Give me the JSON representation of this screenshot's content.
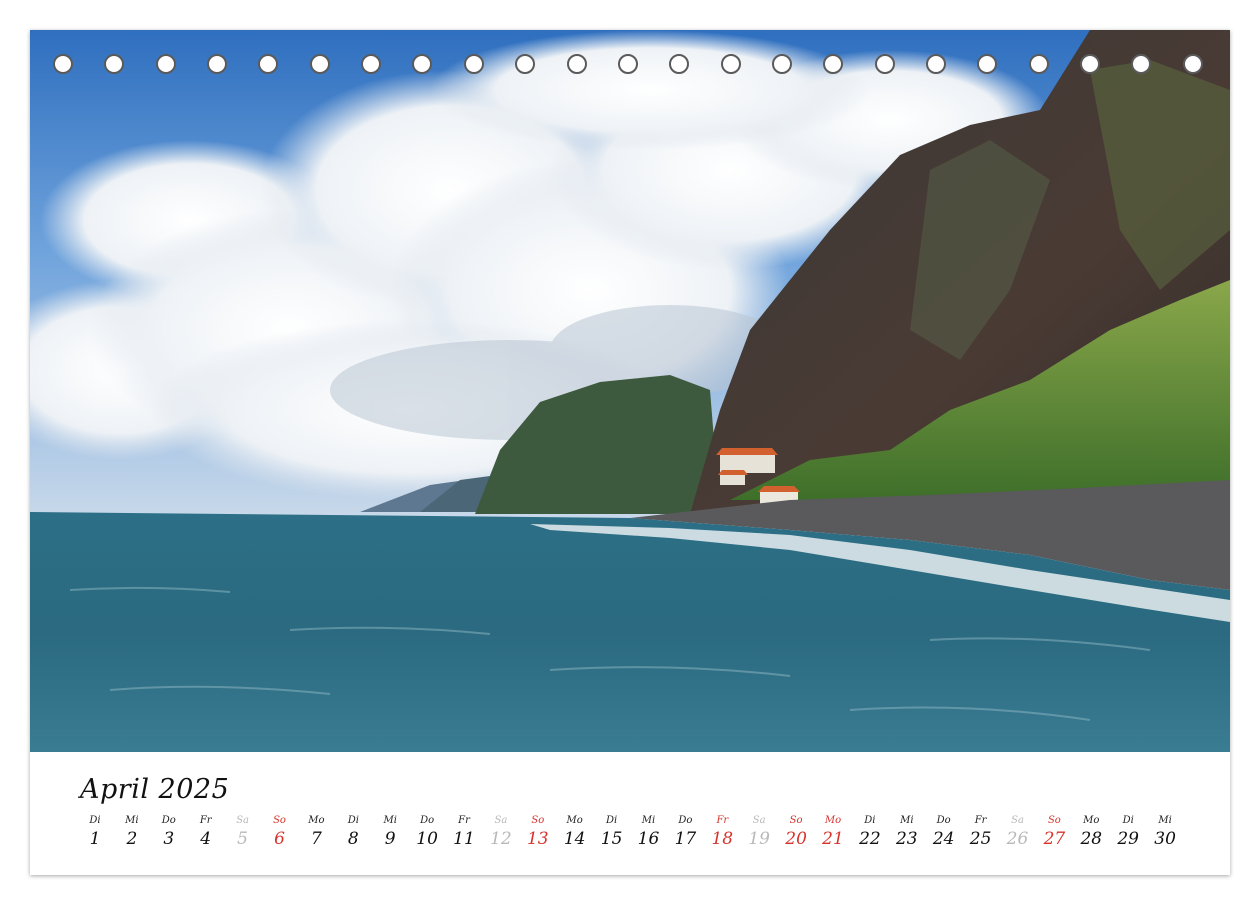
{
  "calendar": {
    "month_title": "April 2025",
    "days": [
      {
        "wd": "Di",
        "num": "1",
        "kind": "normal"
      },
      {
        "wd": "Mi",
        "num": "2",
        "kind": "normal"
      },
      {
        "wd": "Do",
        "num": "3",
        "kind": "normal"
      },
      {
        "wd": "Fr",
        "num": "4",
        "kind": "normal"
      },
      {
        "wd": "Sa",
        "num": "5",
        "kind": "sat"
      },
      {
        "wd": "So",
        "num": "6",
        "kind": "red"
      },
      {
        "wd": "Mo",
        "num": "7",
        "kind": "normal"
      },
      {
        "wd": "Di",
        "num": "8",
        "kind": "normal"
      },
      {
        "wd": "Mi",
        "num": "9",
        "kind": "normal"
      },
      {
        "wd": "Do",
        "num": "10",
        "kind": "normal"
      },
      {
        "wd": "Fr",
        "num": "11",
        "kind": "normal"
      },
      {
        "wd": "Sa",
        "num": "12",
        "kind": "sat"
      },
      {
        "wd": "So",
        "num": "13",
        "kind": "red"
      },
      {
        "wd": "Mo",
        "num": "14",
        "kind": "normal"
      },
      {
        "wd": "Di",
        "num": "15",
        "kind": "normal"
      },
      {
        "wd": "Mi",
        "num": "16",
        "kind": "normal"
      },
      {
        "wd": "Do",
        "num": "17",
        "kind": "normal"
      },
      {
        "wd": "Fr",
        "num": "18",
        "kind": "red"
      },
      {
        "wd": "Sa",
        "num": "19",
        "kind": "sat"
      },
      {
        "wd": "So",
        "num": "20",
        "kind": "red"
      },
      {
        "wd": "Mo",
        "num": "21",
        "kind": "red"
      },
      {
        "wd": "Di",
        "num": "22",
        "kind": "normal"
      },
      {
        "wd": "Mi",
        "num": "23",
        "kind": "normal"
      },
      {
        "wd": "Do",
        "num": "24",
        "kind": "normal"
      },
      {
        "wd": "Fr",
        "num": "25",
        "kind": "normal"
      },
      {
        "wd": "Sa",
        "num": "26",
        "kind": "sat"
      },
      {
        "wd": "So",
        "num": "27",
        "kind": "red"
      },
      {
        "wd": "Mo",
        "num": "28",
        "kind": "normal"
      },
      {
        "wd": "Di",
        "num": "29",
        "kind": "normal"
      },
      {
        "wd": "Mi",
        "num": "30",
        "kind": "normal"
      }
    ]
  },
  "colors": {
    "holiday_red": "#d8332c",
    "saturday_grey": "#b9b9b9",
    "sky_blue": "#3f7fc7",
    "sea_teal": "#2f6f84"
  },
  "binding": {
    "hole_count": 23
  }
}
